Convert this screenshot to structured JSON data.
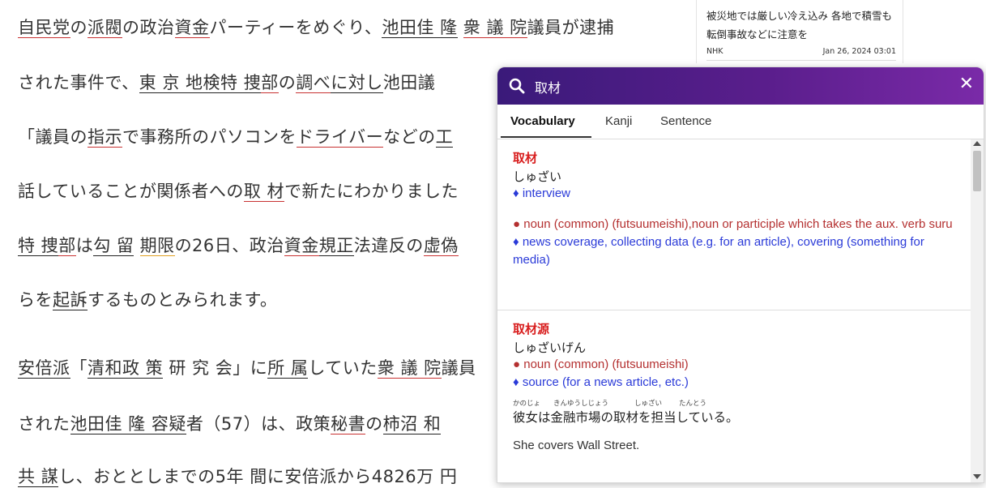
{
  "article": {
    "line1": "自民党の派閥の政治資金パーティーをめぐり、池田佳隆衆議院議員が逮捕",
    "line2": "された事件で、東京地検特捜部の調べに対し池田議",
    "line3": "「議員の指示で事務所のパソコンをドライバーなどの工",
    "line4": "話していることが関係者への取材で新たにわかりました",
    "line5": "特捜部は勾留期限の26日、政治資金規正法違反の虚偽",
    "line6": "らを起訴するものとみられます。",
    "line7": "安倍派「清和政策研究会」に所属していた衆議院議員",
    "line8": "された池田佳隆容疑者（57）は、政策秘書の柿沼和",
    "line9": "共謀し、おととしまでの5年間に安倍派から4826万円"
  },
  "sidebar": {
    "text": "被災地では厳しい冷え込み 各地で積雪も 転倒事故などに注意を",
    "source": "NHK",
    "date": "Jan 26, 2024 03:01"
  },
  "popup": {
    "query": "取材",
    "tabs": [
      "Vocabulary",
      "Kanji",
      "Sentence"
    ],
    "entry1": {
      "word": "取材",
      "reading": "しゅざい",
      "gloss1": "♦ interview",
      "pos": "● noun (common) (futsuumeishi),noun or participle which takes the aux. verb suru",
      "gloss2": "♦ news coverage, collecting data (e.g. for an article), covering (something for media)"
    },
    "entry2": {
      "word": "取材源",
      "reading": "しゅざいげん",
      "pos": "● noun (common) (futsuumeishi)",
      "gloss": "♦ source (for a news article, etc.)",
      "example": "彼女は金融市場の取材を担当している。",
      "furigana": [
        "かのじょ",
        "きんゆうしじょう",
        "しゅざい",
        "たんとう"
      ],
      "english": "She covers Wall Street."
    }
  }
}
